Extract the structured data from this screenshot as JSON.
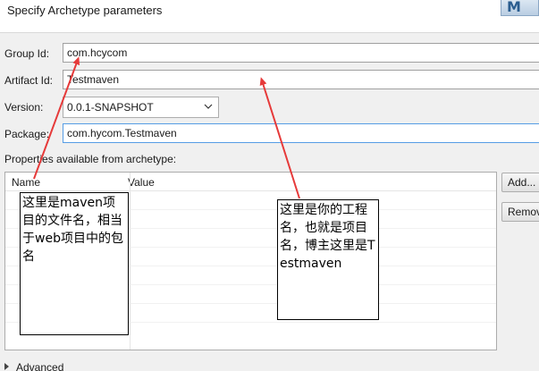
{
  "dialog": {
    "title": "Specify Archetype parameters",
    "logo_text": "M"
  },
  "form": {
    "group_id_label": "Group Id:",
    "group_id_value": "com.hcycom",
    "artifact_id_label": "Artifact Id:",
    "artifact_id_value": "Testmaven",
    "version_label": "Version:",
    "version_value": "0.0.1-SNAPSHOT",
    "package_label": "Package:",
    "package_value": "com.hycom.Testmaven"
  },
  "properties": {
    "label": "Properties available from archetype:",
    "columns": [
      "Name",
      "Value"
    ],
    "add_button": "Add...",
    "remove_button": "Remove"
  },
  "advanced": {
    "label": "Advanced"
  },
  "annotations": {
    "note_left": "这里是maven项目的文件名，相当于web项目中的包名",
    "note_right": "这里是你的工程名，也就是项目名，博主这里是Testmaven",
    "arrow_color": "#e63a3a"
  }
}
